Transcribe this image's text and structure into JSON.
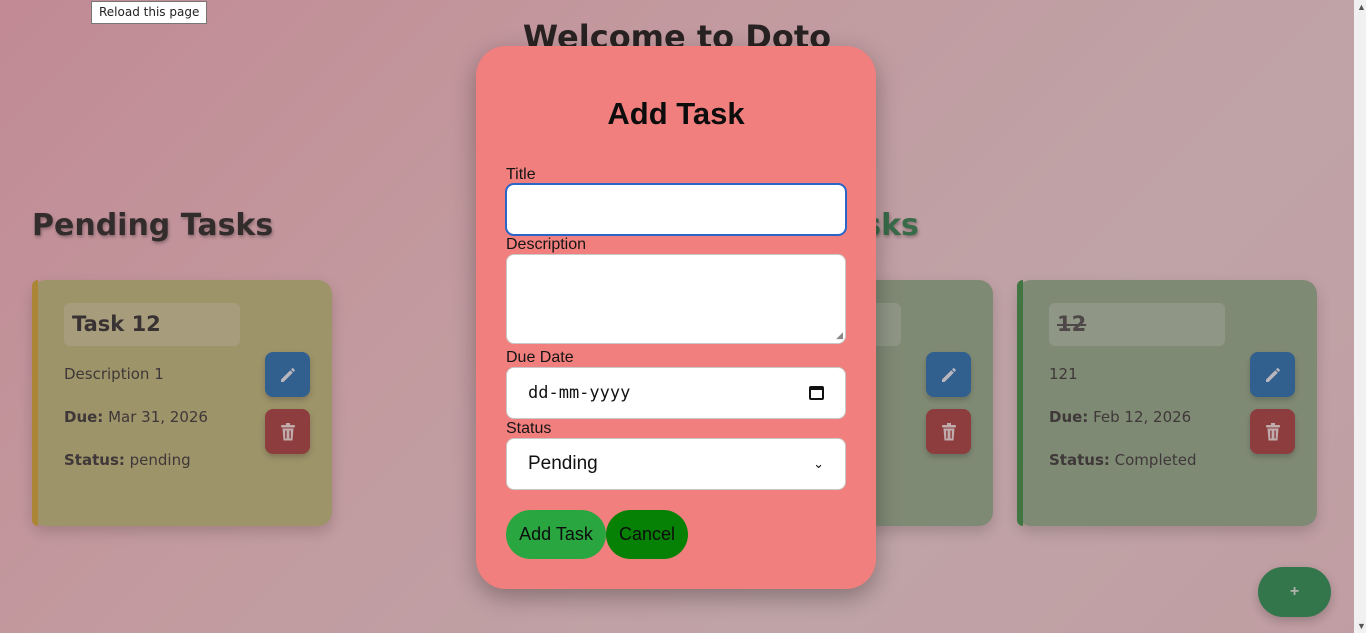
{
  "app": {
    "title": "Welcome to Doto"
  },
  "tooltip": {
    "text": "Reload this page"
  },
  "sections": {
    "pending": {
      "title": "Pending Tasks"
    },
    "completed": {
      "title": "asks"
    }
  },
  "tasks": {
    "pending": [
      {
        "title": "Task 12",
        "description": "Description 1",
        "due_label": "Due:",
        "due": "Mar 31, 2026",
        "status_label": "Status:",
        "status": "pending"
      }
    ],
    "completed": [
      {
        "title": "",
        "description": "",
        "due": "",
        "status": ""
      },
      {
        "title": "12",
        "description": "121",
        "due_label": "Due:",
        "due": "Feb 12, 2026",
        "status_label": "Status:",
        "status": "Completed"
      }
    ]
  },
  "icons": {
    "edit": "pencil-icon",
    "delete": "trash-icon"
  },
  "colors": {
    "pending_card": "#bdb878",
    "completed_card": "#8eaa89",
    "edit_button": "#1668b0",
    "delete_button": "#a33434",
    "modal": "#f07f7e",
    "add_button": "#2aa640",
    "cancel_button": "#078006",
    "fab": "#1b8a4b"
  },
  "fab": {
    "label": "+"
  },
  "modal": {
    "title": "Add Task",
    "title_label": "Title",
    "title_value": "",
    "description_label": "Description",
    "description_value": "",
    "due_label": "Due Date",
    "due_placeholder": "dd-mm-yyyy",
    "status_label": "Status",
    "status_value": "Pending",
    "add_label": "Add Task",
    "cancel_label": "Cancel"
  }
}
